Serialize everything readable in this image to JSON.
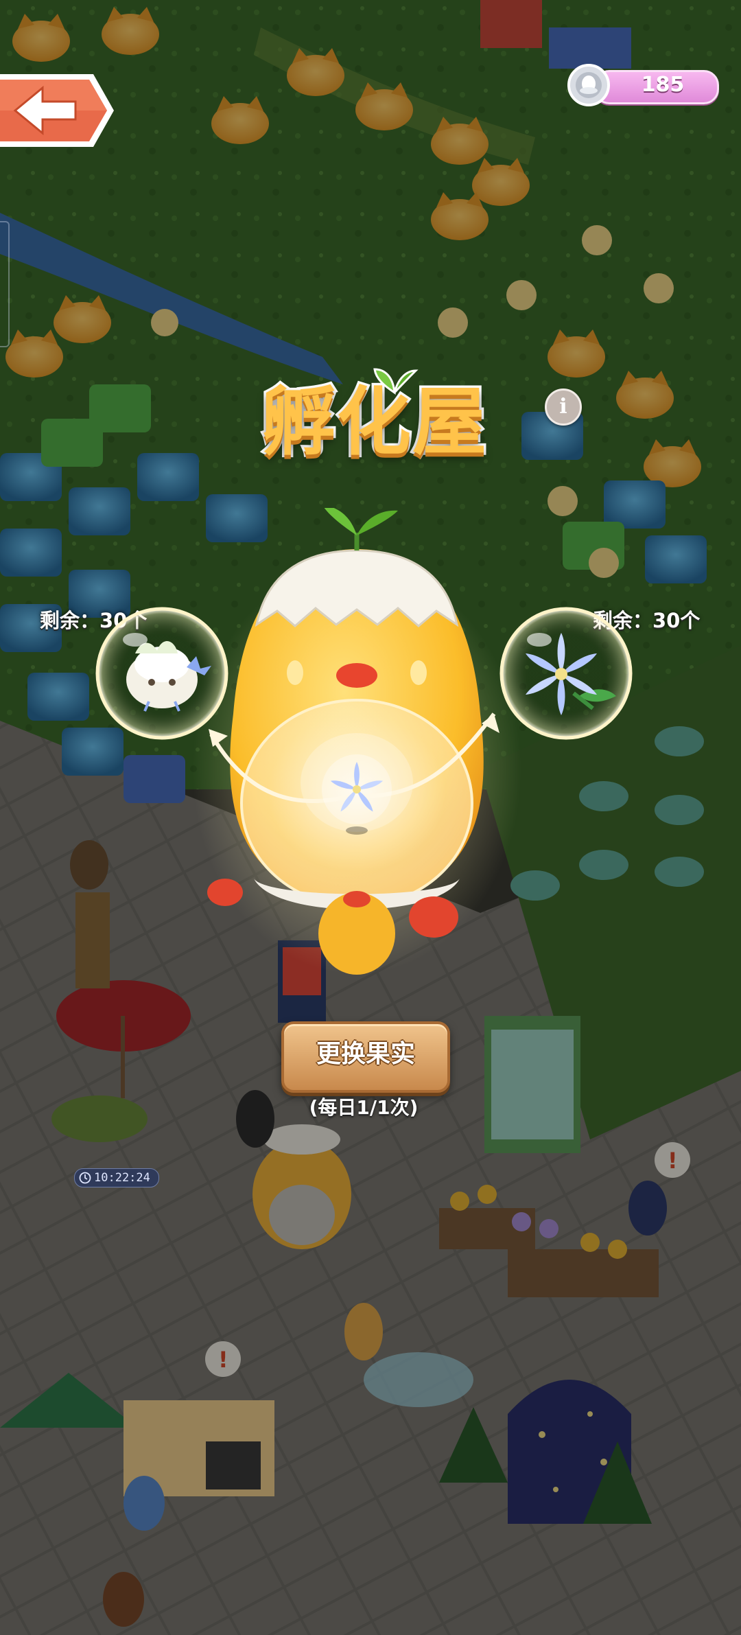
{
  "currency": {
    "amount": "185",
    "icon": "silver-coin-icon"
  },
  "header": {
    "title": "孵化屋",
    "info_icon_label": "i"
  },
  "incubator": {
    "left_item": {
      "remaining_label": "剩余：30个",
      "icon": "white-mushroom-creature-icon"
    },
    "right_item": {
      "remaining_label": "剩余：30个",
      "icon": "blue-lily-flower-icon"
    },
    "current_fruit_icon": "blue-lily-flower-icon"
  },
  "actions": {
    "change_fruit_label": "更换果实",
    "daily_limit_label": "(每日1/1次)"
  },
  "scene": {
    "timer_text": "10:22:24"
  },
  "colors": {
    "title_fill": "#ffc34a",
    "button_fill": "#e0a868",
    "currency_pill": "#f0a3e6",
    "back_button": "#e86a4a"
  }
}
